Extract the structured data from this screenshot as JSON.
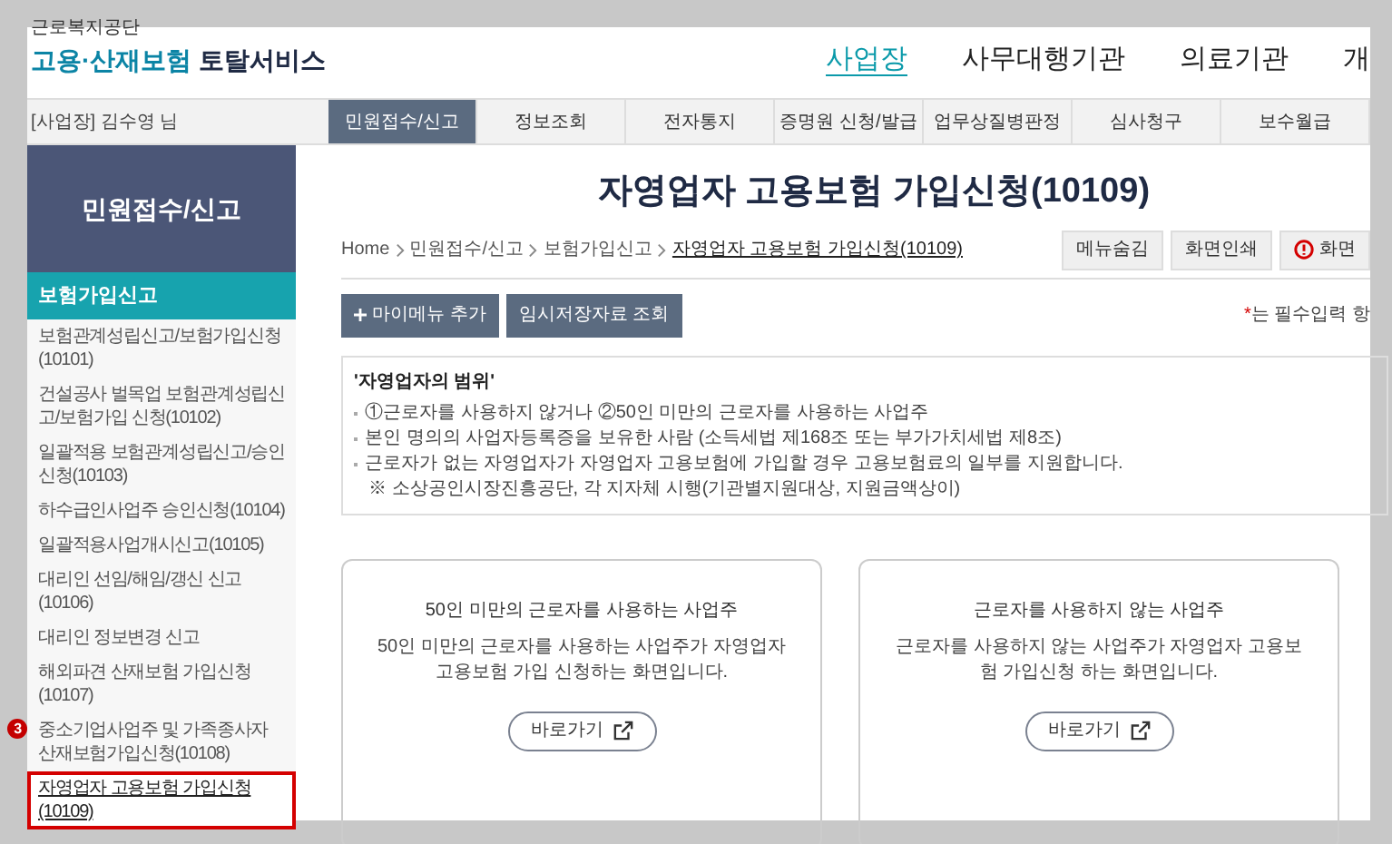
{
  "logo": {
    "org": "근로복지공단",
    "title_part1": "고용·산재보험",
    "title_part2": "토탈서비스"
  },
  "top_nav": [
    {
      "label": "사업장",
      "selected": true
    },
    {
      "label": "사무대행기관",
      "selected": false
    },
    {
      "label": "의료기관",
      "selected": false
    },
    {
      "label": "개",
      "selected": false
    }
  ],
  "user": "[사업장] 김수영 님",
  "tabs": [
    {
      "label": "민원접수/신고",
      "selected": true
    },
    {
      "label": "정보조회",
      "selected": false
    },
    {
      "label": "전자통지",
      "selected": false
    },
    {
      "label": "증명원 신청/발급",
      "selected": false
    },
    {
      "label": "업무상질병판정",
      "selected": false
    },
    {
      "label": "심사청구",
      "selected": false
    },
    {
      "label": "보수월급",
      "selected": false
    }
  ],
  "sidebar": {
    "title": "민원접수/신고",
    "section": "보험가입신고",
    "items": [
      {
        "label": "보험관계성립신고/보험가입신청(10101)",
        "selected": false,
        "highlighted": false
      },
      {
        "label": "건설공사 벌목업 보험관계성립신고/보험가입 신청(10102)",
        "selected": false,
        "highlighted": false
      },
      {
        "label": "일괄적용 보험관계성립신고/승인신청(10103)",
        "selected": false,
        "highlighted": false
      },
      {
        "label": "하수급인사업주 승인신청(10104)",
        "selected": false,
        "highlighted": false
      },
      {
        "label": "일괄적용사업개시신고(10105)",
        "selected": false,
        "highlighted": false
      },
      {
        "label": "대리인 선임/해임/갱신 신고(10106)",
        "selected": false,
        "highlighted": false
      },
      {
        "label": "대리인 정보변경 신고",
        "selected": false,
        "highlighted": false
      },
      {
        "label": "해외파견 산재보험 가입신청(10107)",
        "selected": false,
        "highlighted": false
      },
      {
        "label": "중소기업사업주 및 가족종사자 산재보험가입신청(10108)",
        "selected": false,
        "highlighted": false,
        "marker": "3"
      },
      {
        "label": "자영업자 고용보험 가입신청(10109)",
        "selected": true,
        "highlighted": true
      }
    ]
  },
  "page_title": "자영업자 고용보험 가입신청(10109)",
  "breadcrumb": [
    "Home",
    "민원접수/신고",
    "보험가입신고",
    "자영업자 고용보험 가입신청(10109)"
  ],
  "tool_buttons": [
    {
      "label": "메뉴숨김",
      "kind": "plain"
    },
    {
      "label": "화면인쇄",
      "kind": "plain"
    },
    {
      "label": "화면",
      "kind": "alert"
    }
  ],
  "action_buttons": [
    {
      "label": "마이메뉴 추가",
      "kind": "add"
    },
    {
      "label": "임시저장자료 조회",
      "kind": "plain"
    }
  ],
  "required_note": {
    "mark": "*",
    "text": "는 필수입력 항"
  },
  "info": {
    "title": "'자영업자의 범위'",
    "bullets": [
      "①근로자를 사용하지 않거나 ②50인 미만의 근로자를 사용하는 사업주",
      "본인 명의의 사업자등록증을 보유한 사람 (소득세법 제168조 또는 부가가치세법 제8조)",
      "근로자가 없는 자영업자가 자영업자 고용보험에 가입할 경우 고용보험료의 일부를 지원합니다."
    ],
    "note": "※ 소상공인시장진흥공단, 각 지자체 시행(기관별지원대상, 지원금액상이)"
  },
  "cards": [
    {
      "title": "50인 미만의 근로자를 사용하는 사업주",
      "description": "50인 미만의 근로자를 사용하는 사업주가 자영업자 고용보험 가입 신청하는 화면입니다.",
      "button": "바로가기"
    },
    {
      "title": "근로자를 사용하지 않는 사업주",
      "description": "근로자를 사용하지 않는 사업주가 자영업자 고용보험 가입신청 하는 화면입니다.",
      "button": "바로가기"
    }
  ]
}
